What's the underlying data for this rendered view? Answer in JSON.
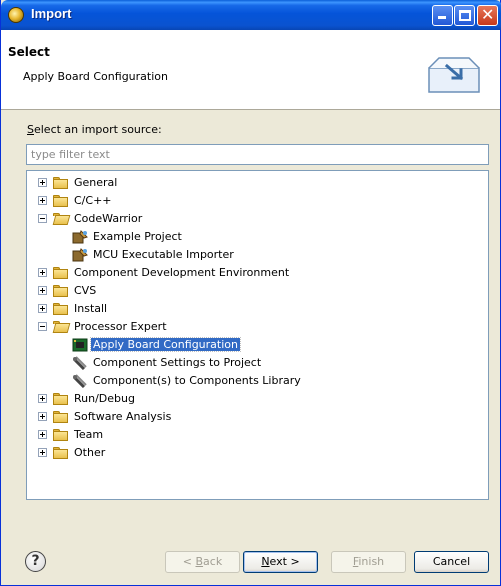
{
  "window": {
    "title": "Import"
  },
  "header": {
    "title": "Select",
    "description": "Apply Board Configuration"
  },
  "filter": {
    "label": "Select an import source:",
    "placeholder": "type filter text"
  },
  "tree": [
    {
      "label": "General",
      "type": "folder",
      "expanded": false,
      "level": 0
    },
    {
      "label": "C/C++",
      "type": "folder",
      "expanded": false,
      "level": 0
    },
    {
      "label": "CodeWarrior",
      "type": "folder",
      "expanded": true,
      "level": 0
    },
    {
      "label": "Example Project",
      "type": "wizard",
      "level": 1
    },
    {
      "label": "MCU Executable Importer",
      "type": "wizard",
      "level": 1
    },
    {
      "label": "Component Development Environment",
      "type": "folder",
      "expanded": false,
      "level": 0
    },
    {
      "label": "CVS",
      "type": "folder",
      "expanded": false,
      "level": 0
    },
    {
      "label": "Install",
      "type": "folder",
      "expanded": false,
      "level": 0
    },
    {
      "label": "Processor Expert",
      "type": "folder",
      "expanded": true,
      "level": 0
    },
    {
      "label": "Apply Board Configuration",
      "type": "chip",
      "level": 1,
      "selected": true
    },
    {
      "label": "Component Settings to Project",
      "type": "tool",
      "level": 1
    },
    {
      "label": "Component(s) to Components Library",
      "type": "tool",
      "level": 1
    },
    {
      "label": "Run/Debug",
      "type": "folder",
      "expanded": false,
      "level": 0
    },
    {
      "label": "Software Analysis",
      "type": "folder",
      "expanded": false,
      "level": 0
    },
    {
      "label": "Team",
      "type": "folder",
      "expanded": false,
      "level": 0
    },
    {
      "label": "Other",
      "type": "folder",
      "expanded": false,
      "level": 0
    }
  ],
  "buttons": {
    "back": {
      "label": "< Back",
      "enabled": false
    },
    "next": {
      "label": "Next >",
      "enabled": true
    },
    "finish": {
      "label": "Finish",
      "enabled": false
    },
    "cancel": {
      "label": "Cancel",
      "enabled": true
    }
  },
  "help_icon": "question-mark"
}
